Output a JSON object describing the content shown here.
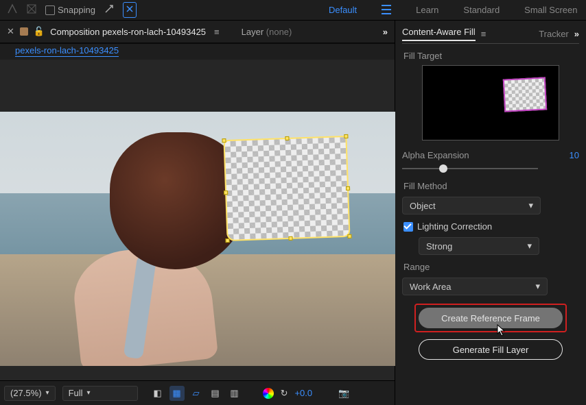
{
  "topbar": {
    "snapping_label": "Snapping",
    "workspaces": {
      "default": "Default",
      "learn": "Learn",
      "standard": "Standard",
      "small": "Small Screen"
    }
  },
  "tabs": {
    "composition_prefix": "Composition",
    "composition_name": "pexels-ron-lach-10493425",
    "layer_prefix": "Layer",
    "layer_value": "(none)",
    "breadcrumb": "pexels-ron-lach-10493425"
  },
  "footer": {
    "zoom": "(27.5%)",
    "resolution": "Full",
    "exposure": "+0.0"
  },
  "panel": {
    "title": "Content-Aware Fill",
    "secondary_tab": "Tracker",
    "fill_target_label": "Fill Target",
    "alpha_label": "Alpha Expansion",
    "alpha_value": "10",
    "fill_method_label": "Fill Method",
    "fill_method_value": "Object",
    "lighting_label": "Lighting Correction",
    "lighting_value": "Strong",
    "range_label": "Range",
    "range_value": "Work Area",
    "create_ref_btn": "Create Reference Frame",
    "generate_btn": "Generate Fill Layer"
  }
}
